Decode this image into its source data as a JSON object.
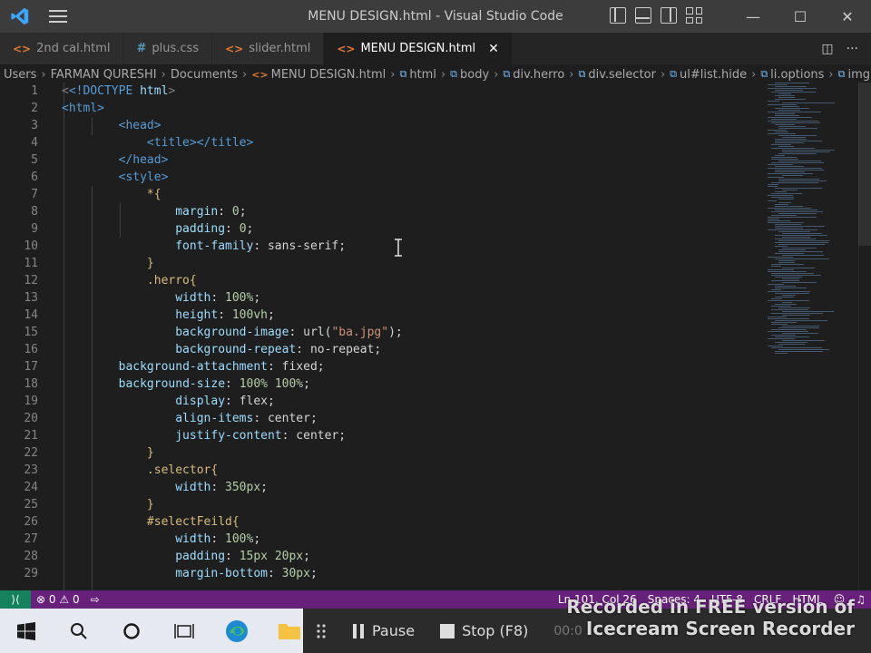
{
  "window": {
    "title": "MENU DESIGN.html - Visual Studio Code",
    "minimize": "—",
    "maximize": "☐",
    "close": "✕"
  },
  "tabs": [
    {
      "label": "2nd cal.html",
      "icon": "<>",
      "active": false
    },
    {
      "label": "plus.css",
      "icon": "#",
      "active": false
    },
    {
      "label": "slider.html",
      "icon": "<>",
      "active": false
    },
    {
      "label": "MENU DESIGN.html",
      "icon": "<>",
      "active": true
    }
  ],
  "tab_close": "✕",
  "tab_actions": {
    "split": "◫",
    "more": "···"
  },
  "breadcrumb": [
    "Users",
    "FARMAN QURESHI",
    "Documents",
    "MENU DESIGN.html",
    "html",
    "body",
    "div.herro",
    "div.selector",
    "ul#list.hide",
    "li.options",
    "img"
  ],
  "line_numbers": [
    "1",
    "2",
    "3",
    "4",
    "5",
    "6",
    "7",
    "8",
    "9",
    "10",
    "11",
    "12",
    "13",
    "14",
    "15",
    "16",
    "17",
    "18",
    "19",
    "20",
    "21",
    "22",
    "23",
    "24",
    "25",
    "26",
    "27",
    "28",
    "29"
  ],
  "code": {
    "l1a": "<!DOCTYPE",
    "l1b": " html",
    "l1c": ">",
    "l2": "<html>",
    "l3": "<head>",
    "l4": "<title></title>",
    "l5": "</head>",
    "l6": "<style>",
    "l7": "*{",
    "l8p": "margin",
    "l8v": "0",
    "l9p": "padding",
    "l9v": "0",
    "l10p": "font-family",
    "l10v": "sans-serif",
    "l11": "}",
    "l12": ".herro{",
    "l13p": "width",
    "l13v": "100%",
    "l14p": "height",
    "l14v": "100vh",
    "l15p": "background-image",
    "l15v": "url(",
    "l15s": "\"ba.jpg\"",
    "l15e": ");",
    "l16p": "background-repeat",
    "l16v": "no-repeat",
    "l17p": "background-attachment",
    "l17v": "fixed",
    "l18p": "background-size",
    "l18v": "100% 100%",
    "l19p": "display",
    "l19v": "flex",
    "l20p": "align-items",
    "l20v": "center",
    "l21p": "justify-content",
    "l21v": "center",
    "l22": "}",
    "l23": ".selector{",
    "l24p": "width",
    "l24v": "350px",
    "l25": "}",
    "l26": "#selectFeild{",
    "l27p": "width",
    "l27v": "100%",
    "l28p": "padding",
    "l28v": "15px 20px",
    "l29p": "margin-bottom",
    "l29v": "30px"
  },
  "status": {
    "errors": "0",
    "warnings": "0",
    "position": "Ln 101, Col 26",
    "spaces": "Spaces: 4",
    "encoding": "UTF-8",
    "eol": "CRLF",
    "language": "HTML"
  },
  "recorder": {
    "pause": "Pause",
    "stop": "Stop (F8)",
    "time": "00:0",
    "watermark_line1": "Recorded in FREE version of",
    "watermark_line2": "Icecream Screen Recorder"
  },
  "colors": {
    "statusbar": "#68217a",
    "remote": "#16825d",
    "html_icon": "#e37933",
    "css_icon": "#519aba"
  }
}
